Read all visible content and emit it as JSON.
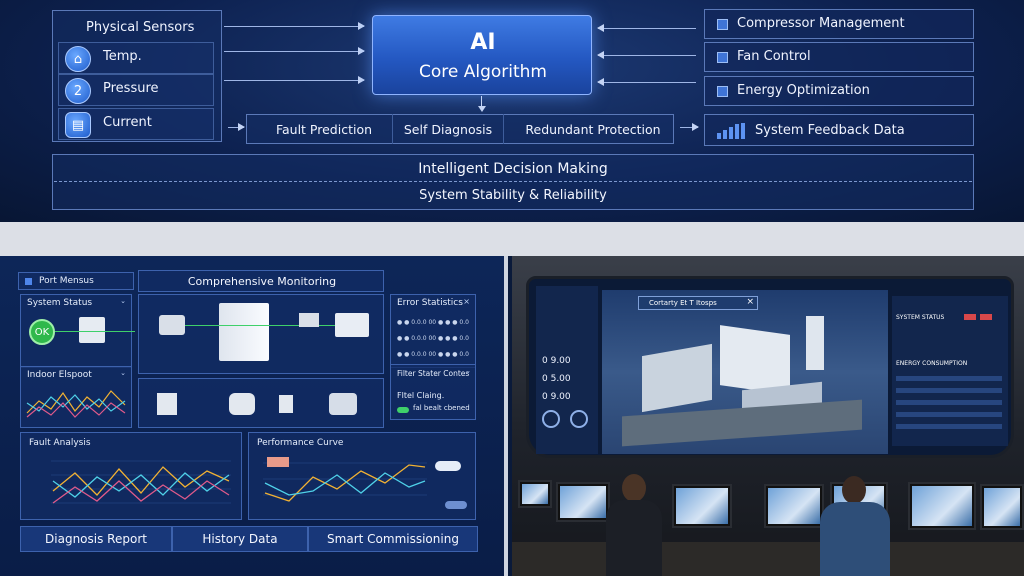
{
  "diagram": {
    "sensors_title": "Physical Sensors",
    "sensors": [
      {
        "label": "Temp.",
        "icon": "home-icon",
        "glyph": "⌂"
      },
      {
        "label": "Pressure",
        "icon": "number-two-icon",
        "glyph": "2"
      },
      {
        "label": "Current",
        "icon": "meter-icon",
        "glyph": "▤"
      }
    ],
    "core": {
      "line1": "AI",
      "line2": "Core Algorithm"
    },
    "functions": [
      "Fault Prediction",
      "Self Diagnosis",
      "Redundant Protection"
    ],
    "outputs": [
      "Compressor Management",
      "Fan Control",
      "Energy Optimization"
    ],
    "feedback": "System Feedback Data",
    "bar1": "Intelligent Decision Making",
    "bar2": "System Stability & Reliability"
  },
  "dashboard": {
    "menu_label": "Port Mensus",
    "monitoring_title": "Comprehensive Monitoring",
    "system_status_title": "System Status",
    "status_badge": "OK",
    "indoor_title": "Indoor Elspoot",
    "error_title": "Error Statistics",
    "error_rows": [
      "● ● 0.0.0 00  ● ● ● 0.0",
      "● ● 0.0.0 00  ● ● ● 0.0",
      "● ● 0.0.0 00  ● ● ● 0.0"
    ],
    "filter_title": "Filter Stater Contes",
    "filter_text": "Fltel Claing.",
    "filter_button": "fal bealt cbened",
    "fault_title": "Fault Analysis",
    "performance_title": "Performance Curve",
    "tabs": [
      "Diagnosis Report",
      "History Data",
      "Smart Commissioning"
    ]
  },
  "control_room": {
    "popup_title": "Cortarty Et T Itosps",
    "left_numbers": [
      "0 9.00",
      "0 5.00",
      "0 9.00"
    ],
    "system_status": "SYSTEM STATUS",
    "energy_title": "ENERGY CONSUMPTION"
  }
}
